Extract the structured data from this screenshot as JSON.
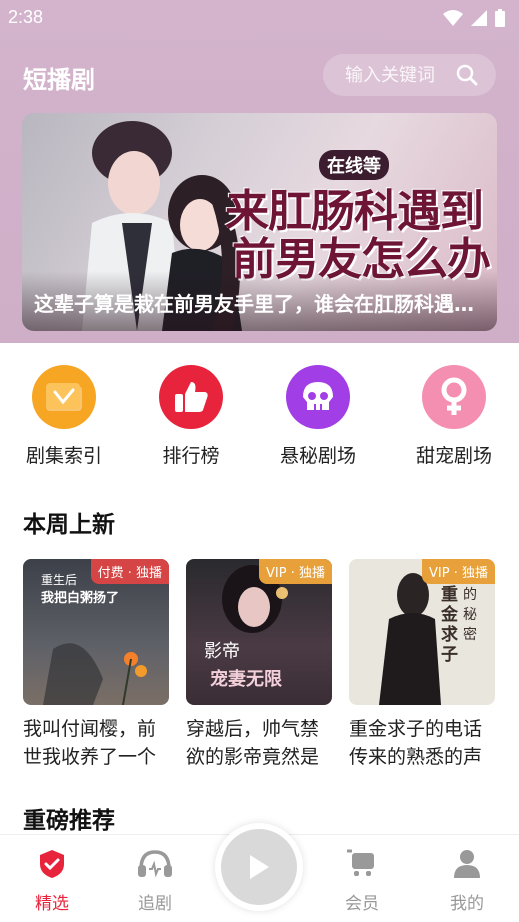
{
  "status": {
    "time": "2:38"
  },
  "header": {
    "title": "短播剧",
    "search_placeholder": "输入关键词"
  },
  "banner": {
    "tag": "在线等",
    "line1": "来肛肠科遇到",
    "line2": "前男友怎么办",
    "caption": "这辈子算是栽在前男友手里了，谁会在肛肠科遇到前男友啊"
  },
  "categories": [
    {
      "label": "剧集索引",
      "icon": "folder-icon",
      "color": "#f6a623"
    },
    {
      "label": "排行榜",
      "icon": "thumbs-up-icon",
      "color": "#e8243c"
    },
    {
      "label": "悬秘剧场",
      "icon": "skull-icon",
      "color": "#a23ee6"
    },
    {
      "label": "甜宠剧场",
      "icon": "female-icon",
      "color": "#f48fb1"
    }
  ],
  "sections": {
    "new_this_week": "本周上新",
    "featured": "重磅推荐"
  },
  "cards": [
    {
      "badge": "付费 · 独播",
      "badge_color": "#d64545",
      "cover_line1": "重生后",
      "cover_line2": "我把白粥扬了",
      "title": "我叫付闻樱，前世我收养了一个孩子"
    },
    {
      "badge": "VIP · 独播",
      "badge_color": "#e8a13a",
      "cover_line1": "影帝",
      "cover_line2": "宠妻无限",
      "title": "穿越后，帅气禁欲的影帝竟然是我老公"
    },
    {
      "badge": "VIP · 独播",
      "badge_color": "#e8a13a",
      "cover_line1": "重金求子",
      "cover_line2": "的秘密",
      "title": "重金求子的电话传来的熟悉的声音"
    }
  ],
  "tabs": [
    {
      "label": "精选",
      "icon": "shield-check-icon",
      "active": true
    },
    {
      "label": "追剧",
      "icon": "headphones-icon",
      "active": false
    },
    {
      "label": "会员",
      "icon": "cart-icon",
      "active": false
    },
    {
      "label": "我的",
      "icon": "person-icon",
      "active": false
    }
  ]
}
